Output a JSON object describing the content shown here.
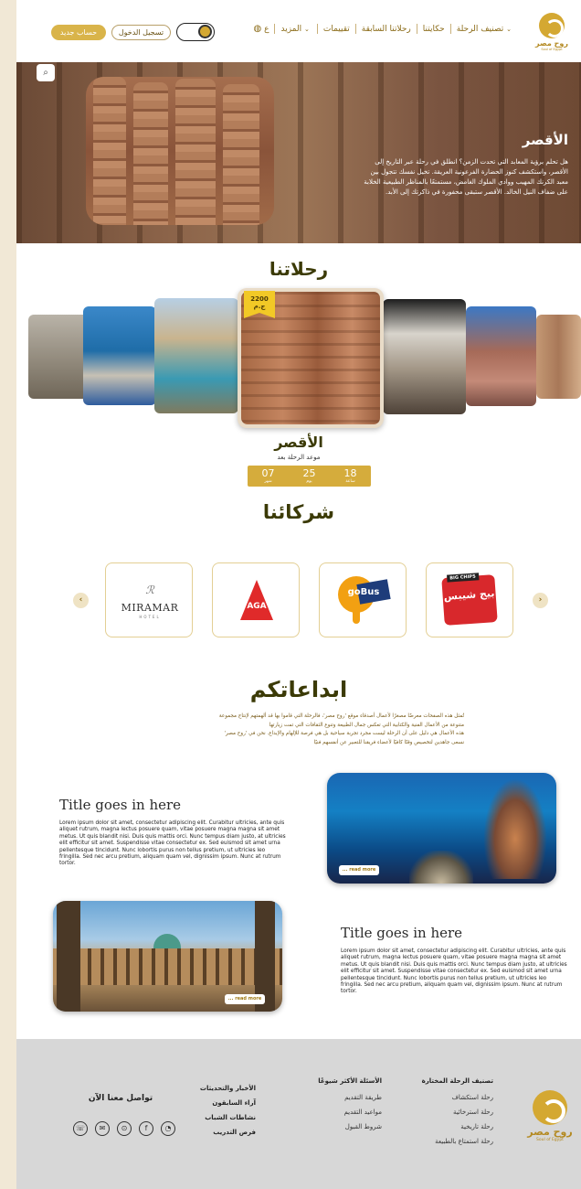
{
  "nav": {
    "logo_text": "روح مصر",
    "logo_sub": "Soul of Egypt",
    "menu": [
      {
        "label": "تصنيف الرحلة",
        "has_dropdown": true
      },
      {
        "label": "حكايتنا",
        "has_dropdown": false
      },
      {
        "label": "رحلاتنا السابقة",
        "has_dropdown": false
      },
      {
        "label": "تقييمات",
        "has_dropdown": false
      },
      {
        "label": "المزيد",
        "has_dropdown": true
      }
    ],
    "language": "ع",
    "login_label": "تسجيل الدخول",
    "signup_label": "حساب جديد",
    "theme_icon": "sun-icon"
  },
  "hero": {
    "title": "الأقصر",
    "text": "هل تحلم برؤية المعابد التي تحدت الزمن؟ انطلق في رحلة عبر التاريخ إلى الأقصر، واستكشف كنوز الحضارة الفرعونية العريقة. تخيل نفسك تتجول بين معبد الكرنك المهيب ووادي الملوك الغامض، مستمتعًا بالمناظر الطبيعية الخلابة على ضفاف النيل الخالد. الأقصر ستبقى محفورة في ذاكرتك إلى الأبد."
  },
  "trips": {
    "title": "رحلاتنا",
    "price": "2200",
    "currency": "ج.م",
    "name": "الأقصر",
    "countdown_label": "موعد الرحلة بعد",
    "countdown": [
      {
        "value": "18",
        "unit": "ساعة"
      },
      {
        "value": "25",
        "unit": "يوم"
      },
      {
        "value": "07",
        "unit": "شهر"
      }
    ]
  },
  "partners": {
    "title": "شركائنا",
    "items": [
      {
        "name": "بيج شيبس",
        "tag": "BIG CHIPS"
      },
      {
        "name": "goBus",
        "tag": "go"
      },
      {
        "name": "AGA",
        "tag": "AGA"
      },
      {
        "name": "MIRAMAR",
        "tag": "HOTEL"
      }
    ]
  },
  "creativity": {
    "title": "ابداعاتكم",
    "lines": [
      "تُمثل هذه الصفحات معرضًا مصغرًا لأعمال أصدقاء موقع 'روح مصر'، فالرحلة التي قاموا بها قد ألهمتهم لإنتاج مجموعة",
      "متنوعة من الأعمال الفنية والكتابية التي تعكس جمال الطبيعة وتنوع الثقافات التي تمت زيارتها",
      "هذه الأعمال هي دليل على أن الرحلة ليست مجرد تجربة سياحية بل هي فرصة للإلهام والإبداع. نحن في 'روح مصر'",
      "نسعى جاهدين لتخصيص وقتًا كافيًا لأعضاء فريقنا للتعبير عن أنفسهم فنيًا"
    ],
    "articles": [
      {
        "title": "Title goes in here",
        "body": "Lorem ipsum dolor sit amet, consectetur adipiscing elit. Curabitur ultricies, ante quis aliquet rutrum, magna lectus posuere quam, vitae posuere magna magna sit amet metus. Ut quis blandit nisi. Duis quis mattis orci. Nunc tempus diam justo, at ultricies elit efficitur sit amet. Suspendisse vitae consectetur ex. Sed euismod sit amet urna pellentesque tincidunt. Nunc lobortis purus non tellus pretium, ut ultricies leo fringilla. Sed nec arcu pretium, aliquam quam vel, dignissim ipsum. Nunc at rutrum tortor.",
        "read_more": "... read more"
      },
      {
        "title": "Title goes in here",
        "body": "Lorem ipsum dolor sit amet, consectetur adipiscing elit. Curabitur ultricies, ante quis aliquet rutrum, magna lectus posuere quam, vitae posuere magna magna sit amet metus. Ut quis blandit nisi. Duis quis mattis orci. Nunc tempus diam justo, at ultricies elit efficitur sit amet. Suspendisse vitae consectetur ex. Sed euismod sit amet urna pellentesque tincidunt. Nunc lobortis purus non tellus pretium, ut ultricies leo fringilla. Sed nec arcu pretium, aliquam quam vel, dignissim ipsum. Nunc at rutrum tortor.",
        "read_more": "... read more"
      }
    ]
  },
  "footer": {
    "logo_text": "روح مصر",
    "logo_sub": "Soul of Egypt",
    "columns": [
      {
        "head": "تصنيف الرحلة المختارة",
        "links": [
          "رحلة استكشاف",
          "رحلة استرخائية",
          "رحلة تاريخية",
          "رحلة استمتاع بالطبيعة"
        ]
      },
      {
        "head": "الأسئلة الأكثر شيوعًا",
        "links": [
          "طريقة التقديم",
          "مواعيد التقديم",
          "شروط القبول"
        ]
      },
      {
        "head": "",
        "links": [
          "الأخبار والتحديثات",
          "آراء السابقون",
          "نشاطات الشباب",
          "فرص التدريب"
        ]
      }
    ],
    "contact_title": "تواصل معنا الآن",
    "contact_icons": [
      "whatsapp-icon",
      "facebook-icon",
      "location-icon",
      "email-icon",
      "phone-icon"
    ]
  }
}
